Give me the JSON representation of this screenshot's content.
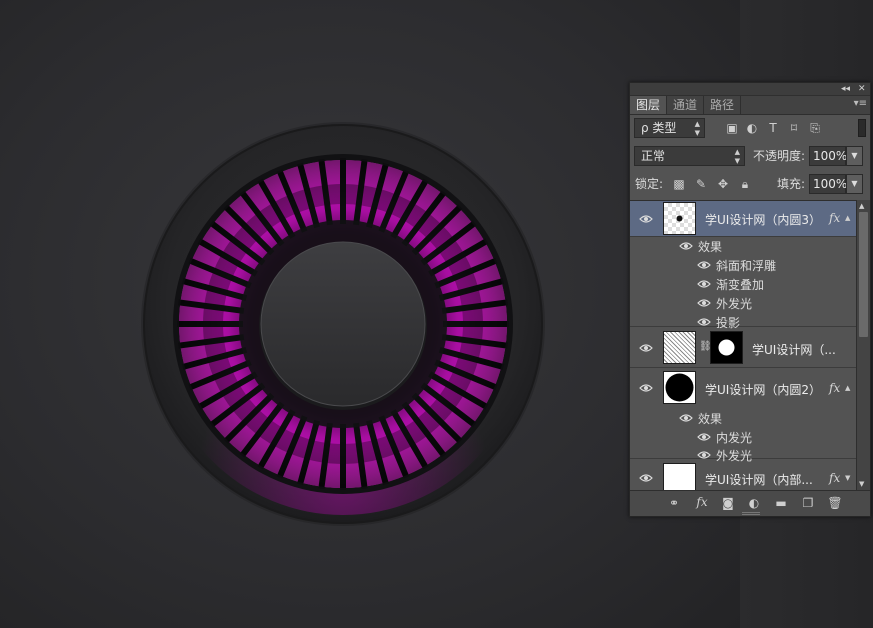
{
  "panel": {
    "collapse_icon": "◂◂",
    "close_icon": "✕",
    "tabs": [
      {
        "label": "图层",
        "active": true
      },
      {
        "label": "通道",
        "active": false
      },
      {
        "label": "路径",
        "active": false
      }
    ],
    "tab_menu_icon": "▾≡",
    "filter": {
      "kind_label": "ρ 类型",
      "filter_icons": [
        "image-filter-icon",
        "adjustment-filter-icon",
        "text-filter-icon",
        "shape-filter-icon",
        "smart-object-filter-icon"
      ]
    },
    "blend_mode": "正常",
    "opacity_label": "不透明度:",
    "opacity_value": "100%",
    "lock_label": "锁定:",
    "fill_label": "填充:",
    "fill_value": "100%",
    "layers": [
      {
        "name": "学UI设计网（内圆3）",
        "selected": true,
        "fx": "fx",
        "effects_label": "效果",
        "effects": [
          "斜面和浮雕",
          "渐变叠加",
          "外发光",
          "投影"
        ]
      },
      {
        "name": "学UI设计网（...",
        "selected": false,
        "has_mask": true
      },
      {
        "name": "学UI设计网（内圆2）",
        "selected": false,
        "fx": "fx",
        "effects_label": "效果",
        "effects": [
          "内发光",
          "外发光"
        ]
      },
      {
        "name": "学UI设计网（内部...",
        "selected": false,
        "fx": "fx"
      }
    ],
    "bottom_icons": [
      "link-layers-icon",
      "fx-icon",
      "add-mask-icon",
      "adjustment-layer-icon",
      "new-group-icon",
      "new-layer-icon",
      "delete-layer-icon"
    ],
    "bottom_fx": "fx"
  },
  "colors": {
    "accent_magenta": "#d400c8",
    "panel_bg": "#535353",
    "selected_layer": "#5d6a84"
  }
}
